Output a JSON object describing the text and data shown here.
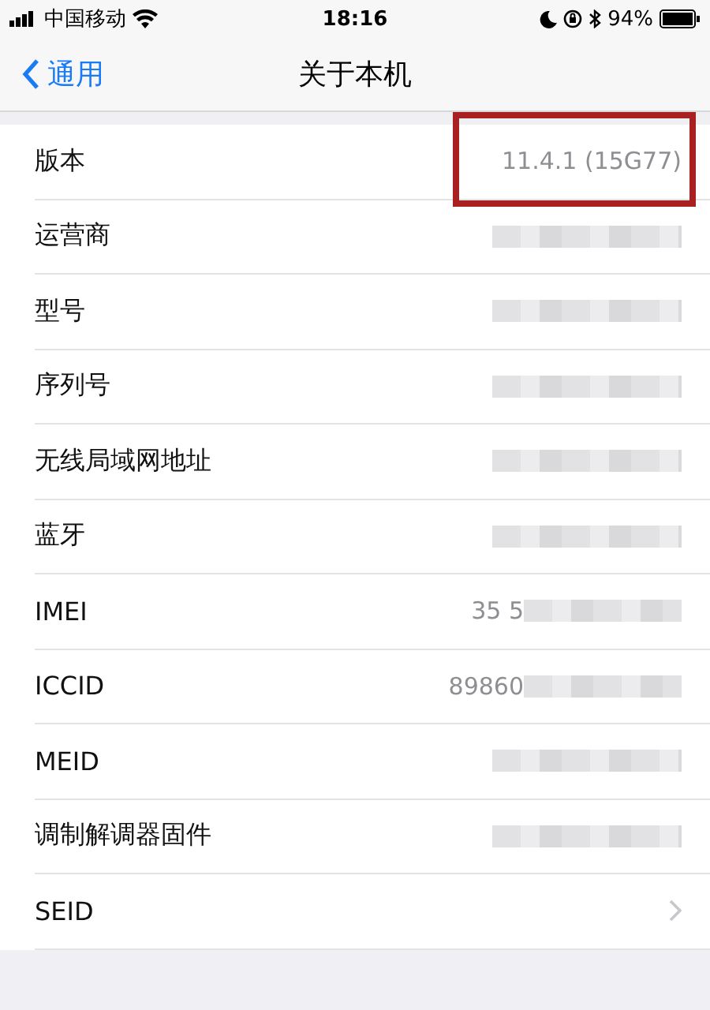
{
  "status_bar": {
    "carrier": "中国移动",
    "time": "18:16",
    "battery": "94%"
  },
  "nav": {
    "back": "通用",
    "title": "关于本机"
  },
  "rows": [
    {
      "label": "版本",
      "kind": "text",
      "value": "11.4.1 (15G77)",
      "highlighted": true
    },
    {
      "label": "运营商",
      "kind": "blurred",
      "highlighted": false
    },
    {
      "label": "型号",
      "kind": "blurred",
      "highlighted": false
    },
    {
      "label": "序列号",
      "kind": "blurred",
      "highlighted": false
    },
    {
      "label": "无线局域网地址",
      "kind": "blurred",
      "highlighted": false
    },
    {
      "label": "蓝牙",
      "kind": "blurred",
      "highlighted": false
    },
    {
      "label": "IMEI",
      "kind": "partial",
      "value": "35 5",
      "highlighted": false
    },
    {
      "label": "ICCID",
      "kind": "partial",
      "value": "89860",
      "highlighted": false
    },
    {
      "label": "MEID",
      "kind": "blurred",
      "highlighted": false
    },
    {
      "label": "调制解调器固件",
      "kind": "blurred",
      "highlighted": false
    },
    {
      "label": "SEID",
      "kind": "link",
      "highlighted": false
    }
  ]
}
